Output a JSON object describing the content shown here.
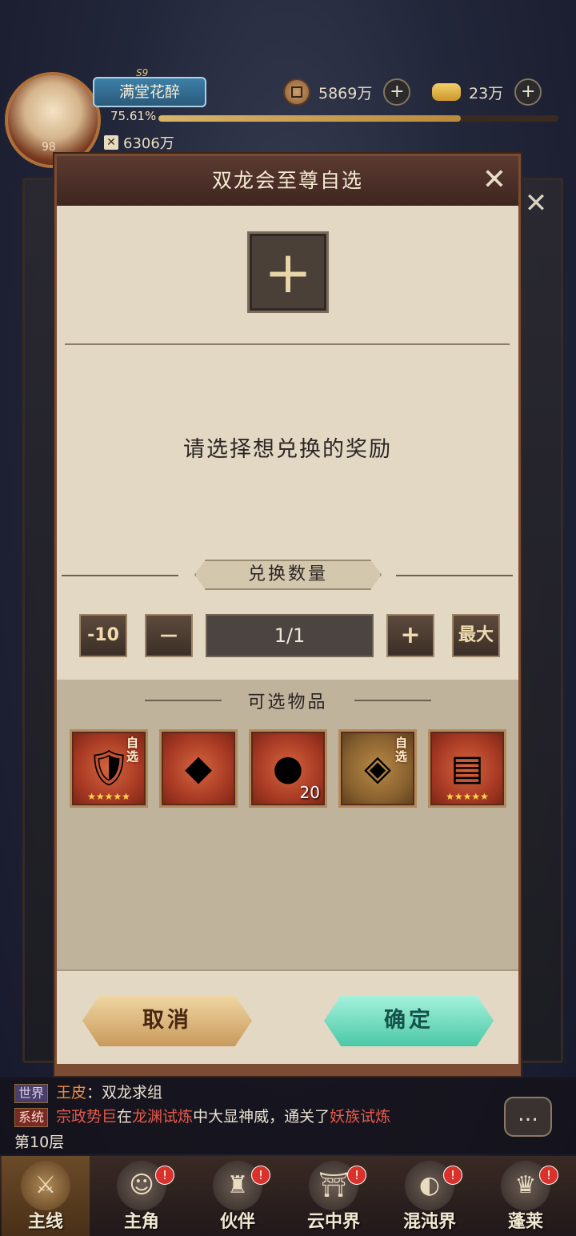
{
  "hud": {
    "server": "S9",
    "player_name": "满堂花醉",
    "level": "98",
    "exp_text": "75.61%",
    "exp_fraction": 0.7561,
    "power": "6306万",
    "power_icon": "crossed-swords-icon",
    "coins": "5869万",
    "coin_icon": "coin-icon",
    "ingots": "23万",
    "ingot_icon": "gold-ingot-icon",
    "add_symbol": "+"
  },
  "modal": {
    "title": "双龙会至尊自选",
    "close_symbol": "✕",
    "slot_symbol": "+",
    "prompt": "请选择想兑换的奖励",
    "quantity_title": "兑换数量",
    "minus10": "-10",
    "minus": "—",
    "quantity": "1/1",
    "plus": "+",
    "max": "最大",
    "items_title": "可选物品",
    "items": [
      {
        "name": "armor-set",
        "tag": "自选",
        "stars": "★★★★★",
        "count": "",
        "style": "red",
        "glyph": "🛡"
      },
      {
        "name": "crystal",
        "tag": "",
        "stars": "",
        "count": "",
        "style": "red",
        "glyph": "◆"
      },
      {
        "name": "fire-orb",
        "tag": "",
        "stars": "",
        "count": "20",
        "style": "red",
        "glyph": "●"
      },
      {
        "name": "cloak",
        "tag": "自选",
        "stars": "",
        "count": "",
        "style": "gold",
        "glyph": "◈"
      },
      {
        "name": "book",
        "tag": "",
        "stars": "★★★★★",
        "count": "",
        "style": "red",
        "glyph": "▤"
      }
    ],
    "cancel": "取消",
    "confirm": "确定"
  },
  "chat": {
    "line1_tag": "世界",
    "line1_user": "王皮",
    "line1_sep": "：",
    "line1_text": "双龙求组",
    "line2_tag": "系统",
    "line2_a": "宗政势巨",
    "line2_b": "在",
    "line2_c": "龙渊试炼",
    "line2_d": "中大显神威，通关了",
    "line2_e": "妖族试炼",
    "line3": "第10层",
    "bubble": "…"
  },
  "nav": {
    "items": [
      {
        "label": "主线",
        "active": true,
        "badge": ""
      },
      {
        "label": "主角",
        "active": false,
        "badge": "!"
      },
      {
        "label": "伙伴",
        "active": false,
        "badge": "!"
      },
      {
        "label": "云中界",
        "active": false,
        "badge": "!"
      },
      {
        "label": "混沌界",
        "active": false,
        "badge": "!"
      },
      {
        "label": "蓬莱",
        "active": false,
        "badge": "!"
      }
    ]
  },
  "colors": {
    "confirm": "#4bc8a6",
    "cancel": "#c99a5c",
    "modal_bg": "#e3d8c4",
    "header": "#4a2e26"
  }
}
